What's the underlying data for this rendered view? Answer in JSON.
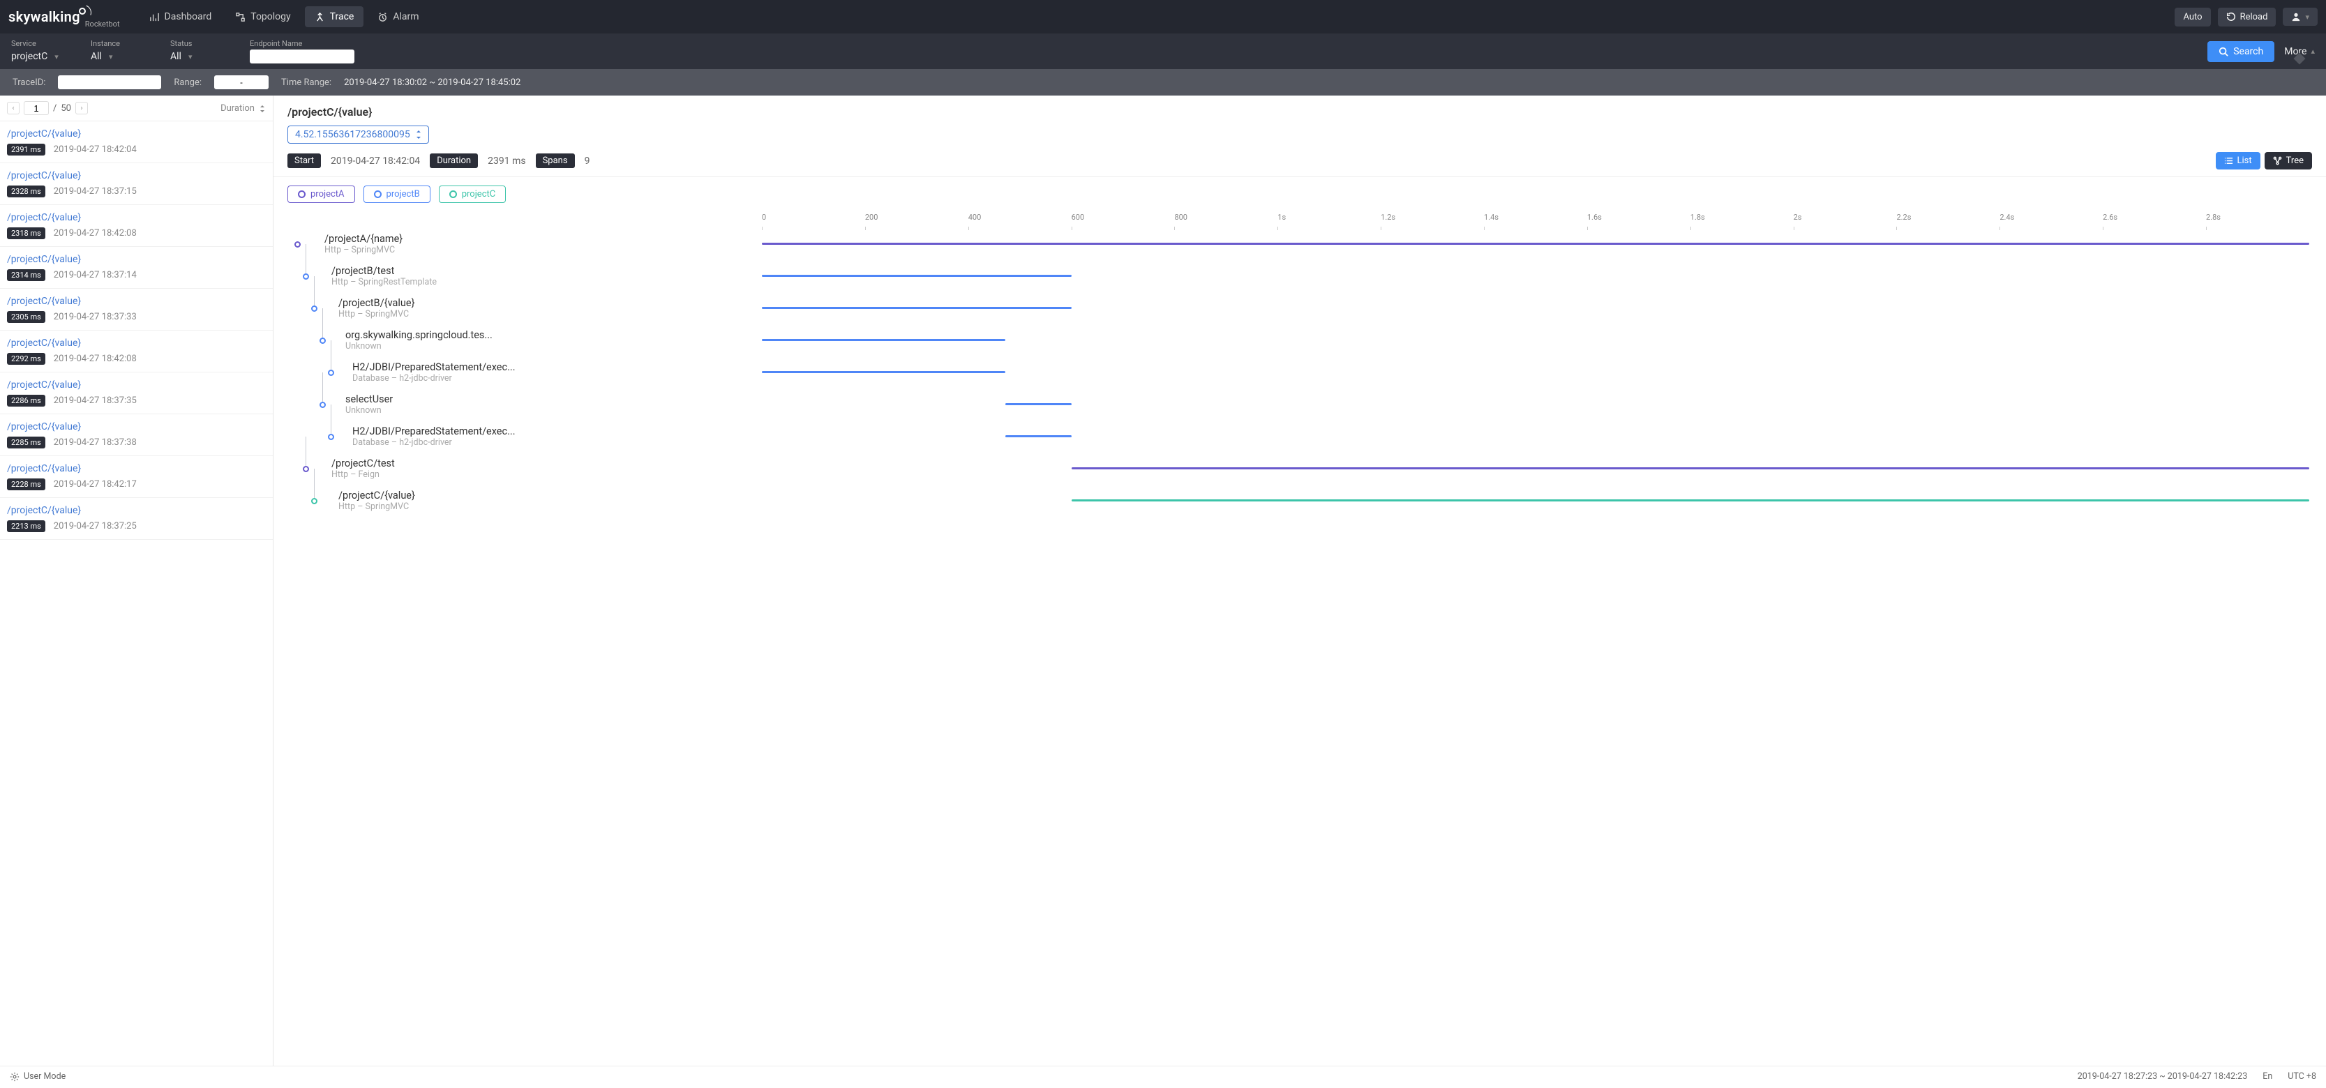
{
  "brand": {
    "main": "skywalking",
    "sub": "Rocketbot"
  },
  "nav": {
    "tabs": [
      {
        "id": "dashboard",
        "label": "Dashboard"
      },
      {
        "id": "topology",
        "label": "Topology"
      },
      {
        "id": "trace",
        "label": "Trace"
      },
      {
        "id": "alarm",
        "label": "Alarm"
      }
    ],
    "active": "trace",
    "auto": "Auto",
    "reload": "Reload"
  },
  "filters": {
    "service": {
      "label": "Service",
      "value": "projectC"
    },
    "instance": {
      "label": "Instance",
      "value": "All"
    },
    "status": {
      "label": "Status",
      "value": "All"
    },
    "endpoint": {
      "label": "Endpoint Name",
      "value": ""
    },
    "search": "Search",
    "more": "More",
    "traceid_label": "TraceID:",
    "traceid_value": "",
    "range_label": "Range:",
    "range_value": "-",
    "timerange_label": "Time Range:",
    "timerange_value": "2019-04-27 18:30:02 ~ 2019-04-27 18:45:02"
  },
  "list_head": {
    "page": "1",
    "total_pages": "50",
    "sort_label": "Duration"
  },
  "traces": [
    {
      "name": "/projectC/{value}",
      "duration": "2391 ms",
      "ts": "2019-04-27 18:42:04"
    },
    {
      "name": "/projectC/{value}",
      "duration": "2328 ms",
      "ts": "2019-04-27 18:37:15"
    },
    {
      "name": "/projectC/{value}",
      "duration": "2318 ms",
      "ts": "2019-04-27 18:42:08"
    },
    {
      "name": "/projectC/{value}",
      "duration": "2314 ms",
      "ts": "2019-04-27 18:37:14"
    },
    {
      "name": "/projectC/{value}",
      "duration": "2305 ms",
      "ts": "2019-04-27 18:37:33"
    },
    {
      "name": "/projectC/{value}",
      "duration": "2292 ms",
      "ts": "2019-04-27 18:42:08"
    },
    {
      "name": "/projectC/{value}",
      "duration": "2286 ms",
      "ts": "2019-04-27 18:37:35"
    },
    {
      "name": "/projectC/{value}",
      "duration": "2285 ms",
      "ts": "2019-04-27 18:37:38"
    },
    {
      "name": "/projectC/{value}",
      "duration": "2228 ms",
      "ts": "2019-04-27 18:42:17"
    },
    {
      "name": "/projectC/{value}",
      "duration": "2213 ms",
      "ts": "2019-04-27 18:37:25"
    }
  ],
  "detail": {
    "title": "/projectC/{value}",
    "traceid": "4.52.15563617236800095",
    "start_label": "Start",
    "start_value": "2019-04-27 18:42:04",
    "duration_label": "Duration",
    "duration_value": "2391 ms",
    "spans_label": "Spans",
    "spans_value": "9",
    "view_list": "List",
    "view_tree": "Tree"
  },
  "legend": [
    {
      "name": "projectA",
      "color": "#6a5acd"
    },
    {
      "name": "projectB",
      "color": "#4f86f7"
    },
    {
      "name": "projectC",
      "color": "#3cc4a9"
    }
  ],
  "axis": [
    "0",
    "200",
    "400",
    "600",
    "800",
    "1s",
    "1.2s",
    "1.4s",
    "1.6s",
    "1.8s",
    "2s",
    "2.2s",
    "2.4s",
    "2.6s",
    "2.8s"
  ],
  "chart_data": {
    "type": "gantt",
    "x_unit": "ms",
    "x_range": [
      0,
      2800
    ],
    "ticks_ms": [
      0,
      200,
      400,
      600,
      800,
      1000,
      1200,
      1400,
      1600,
      1800,
      2000,
      2200,
      2400,
      2600,
      2800
    ],
    "spans": [
      {
        "name": "/projectA/{name}",
        "layer": "Http – SpringMVC",
        "indent": 0,
        "series": "projectA",
        "start_ms": 0,
        "end_ms": 2800
      },
      {
        "name": "/projectB/test",
        "layer": "Http – SpringRestTemplate",
        "indent": 1,
        "series": "projectB",
        "start_ms": 0,
        "end_ms": 560
      },
      {
        "name": "/projectB/{value}",
        "layer": "Http – SpringMVC",
        "indent": 2,
        "series": "projectB",
        "start_ms": 0,
        "end_ms": 560
      },
      {
        "name": "org.skywalking.springcloud.tes...",
        "layer": "Unknown",
        "indent": 3,
        "series": "projectB",
        "start_ms": 0,
        "end_ms": 440
      },
      {
        "name": "H2/JDBI/PreparedStatement/exec...",
        "layer": "Database – h2-jdbc-driver",
        "indent": 4,
        "series": "projectB",
        "start_ms": 0,
        "end_ms": 440
      },
      {
        "name": "selectUser",
        "layer": "Unknown",
        "indent": 3,
        "series": "projectB",
        "start_ms": 440,
        "end_ms": 560
      },
      {
        "name": "H2/JDBI/PreparedStatement/exec...",
        "layer": "Database – h2-jdbc-driver",
        "indent": 4,
        "series": "projectB",
        "start_ms": 440,
        "end_ms": 560
      },
      {
        "name": "/projectC/test",
        "layer": "Http – Feign",
        "indent": 1,
        "series": "projectA",
        "start_ms": 560,
        "end_ms": 2800
      },
      {
        "name": "/projectC/{value}",
        "layer": "Http – SpringMVC",
        "indent": 2,
        "series": "projectC",
        "start_ms": 560,
        "end_ms": 2800
      }
    ]
  },
  "footer": {
    "user_mode": "User Mode",
    "timerange": "2019-04-27 18:27:23 ~ 2019-04-27 18:42:23",
    "lang": "En",
    "tz": "UTC +8"
  }
}
